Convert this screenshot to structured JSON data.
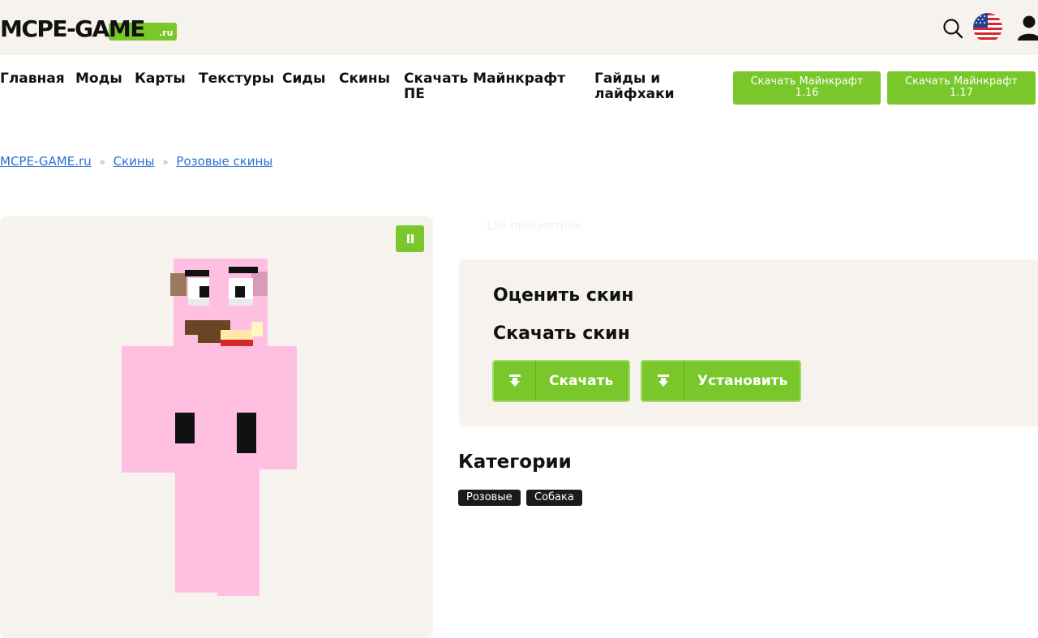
{
  "header": {
    "logo_text": "MCPE-GAME",
    "logo_suffix": ".ru",
    "brand_color": "#79c72a"
  },
  "nav": {
    "items": [
      {
        "label": "Главная"
      },
      {
        "label": "Моды"
      },
      {
        "label": "Карты"
      },
      {
        "label": "Текстуры"
      },
      {
        "label": "Сиды"
      },
      {
        "label": "Скины"
      },
      {
        "label_line1": "Скачать Майнкрафт",
        "label_line2": "ПЕ"
      },
      {
        "label_line1": "Гайды и",
        "label_line2": "лайфхаки"
      }
    ],
    "buttons": [
      {
        "line1": "Скачать Майнкрафт",
        "line2": "1.16"
      },
      {
        "line1": "Скачать Майнкрафт",
        "line2": "1.17"
      }
    ]
  },
  "breadcrumb": {
    "items": [
      "MCPE-GAME.ru",
      "Скины",
      "Розовые скины"
    ],
    "separator": "»"
  },
  "skin": {
    "views": "138 просмотров"
  },
  "panel": {
    "rate_title": "Оценить скин",
    "download_title": "Скачать скин",
    "download_button": "Скачать",
    "install_button": "Установить"
  },
  "categories": {
    "title": "Категории",
    "tags": [
      "Розовые",
      "Собака"
    ]
  }
}
